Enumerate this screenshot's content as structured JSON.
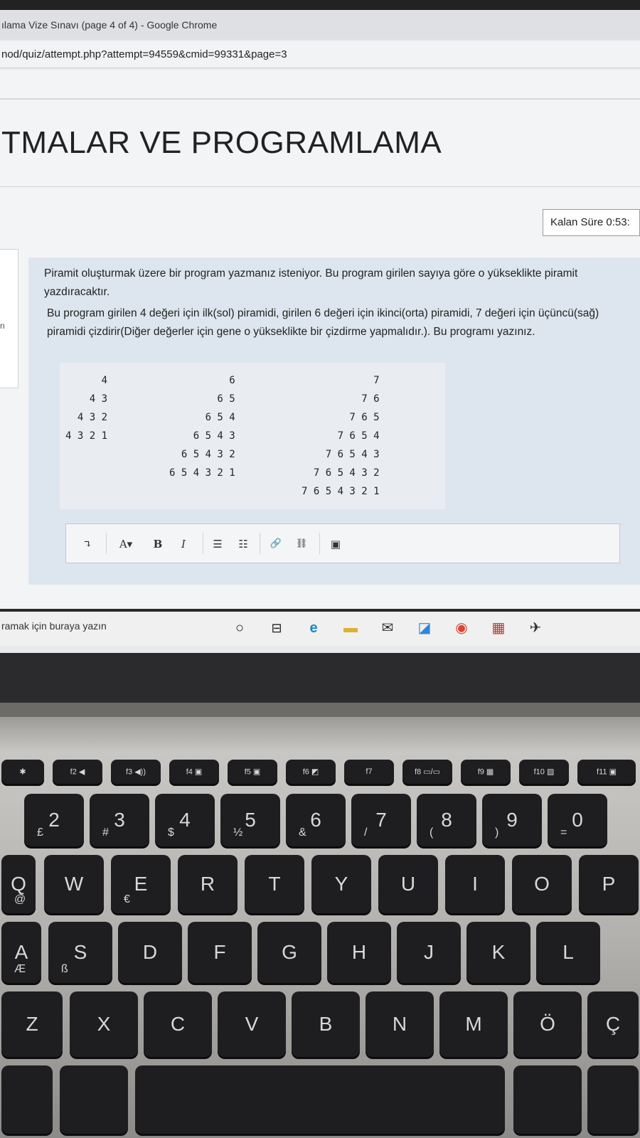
{
  "window": {
    "title": "ılama Vize Sınavı (page 4 of 4) - Google Chrome",
    "url": "nod/quiz/attempt.php?attempt=94559&cmid=99331&page=3"
  },
  "course": {
    "title": "TMALAR VE PROGRAMLAMA"
  },
  "timer": {
    "label": "Kalan Süre 0:53:"
  },
  "sidebar": {
    "fragment": "n"
  },
  "question": {
    "paragraph1": "Piramit oluşturmak üzere bir program yazmanız isteniyor. Bu program girilen sayıya göre o yükseklikte piramit yazdıracaktır.",
    "paragraph2": "Bu program girilen 4 değeri için ilk(sol) piramidi, girilen 6 değeri için ikinci(orta) piramidi, 7 değeri için üçüncü(sağ) piramidi çizdirir(Diğer değerler için gene o yükseklikte bir çizdirme yapmalıdır.). Bu programı yazınız.",
    "pyramid_left": "      4\n    4 3\n  4 3 2\n4 3 2 1",
    "pyramid_middle": "          6\n        6 5\n      6 5 4\n    6 5 4 3\n  6 5 4 3 2\n6 5 4 3 2 1",
    "pyramid_right": "            7\n          7 6\n        7 6 5\n      7 6 5 4\n    7 6 5 4 3\n  7 6 5 4 3 2\n7 6 5 4 3 2 1"
  },
  "editor_toolbar": {
    "expand": "↴",
    "font": "A▾",
    "bold": "B",
    "italic": "I",
    "bullets": "☰",
    "numbered": "☷",
    "link": "🔗",
    "unlink": "⛓",
    "image": "▣"
  },
  "taskbar": {
    "search": "ramak için buraya yazın",
    "icons": [
      "○",
      "⊟",
      "e",
      "▬",
      "✉",
      "◪",
      "◉",
      "▦",
      "✈"
    ]
  },
  "keyboard": {
    "fn_row": [
      "✱",
      "f2 ◀",
      "f3 ◀))",
      "f4 ▣",
      "f5 ▣",
      "f6 ◩",
      "f7",
      "f8 ▭/▭",
      "f9 ▦",
      "f10 ▨",
      "f11 ▣"
    ],
    "num_row": [
      {
        "main": "2",
        "sub": "£"
      },
      {
        "main": "3",
        "sub": "#"
      },
      {
        "main": "4",
        "sub": "$"
      },
      {
        "main": "5",
        "sub": "½"
      },
      {
        "main": "6",
        "sub": "&"
      },
      {
        "main": "7",
        "sub": "/"
      },
      {
        "main": "8",
        "sub": "("
      },
      {
        "main": "9",
        "sub": ")"
      },
      {
        "main": "0",
        "sub": "="
      }
    ],
    "row_q": [
      {
        "main": "Q",
        "sub": "@"
      },
      {
        "main": "W",
        "sub": ""
      },
      {
        "main": "E",
        "sub": "€"
      },
      {
        "main": "R",
        "sub": ""
      },
      {
        "main": "T",
        "sub": ""
      },
      {
        "main": "Y",
        "sub": ""
      },
      {
        "main": "U",
        "sub": ""
      },
      {
        "main": "I",
        "sub": ""
      },
      {
        "main": "O",
        "sub": ""
      },
      {
        "main": "P",
        "sub": ""
      }
    ],
    "row_a": [
      {
        "main": "A",
        "sub": "Æ"
      },
      {
        "main": "S",
        "sub": "ß"
      },
      {
        "main": "D",
        "sub": ""
      },
      {
        "main": "F",
        "sub": ""
      },
      {
        "main": "G",
        "sub": ""
      },
      {
        "main": "H",
        "sub": ""
      },
      {
        "main": "J",
        "sub": ""
      },
      {
        "main": "K",
        "sub": ""
      },
      {
        "main": "L",
        "sub": ""
      }
    ],
    "row_z": [
      {
        "main": "Z",
        "sub": ""
      },
      {
        "main": "X",
        "sub": ""
      },
      {
        "main": "C",
        "sub": ""
      },
      {
        "main": "V",
        "sub": ""
      },
      {
        "main": "B",
        "sub": ""
      },
      {
        "main": "N",
        "sub": ""
      },
      {
        "main": "M",
        "sub": ""
      },
      {
        "main": "Ö",
        "sub": ""
      },
      {
        "main": "Ç",
        "sub": ""
      }
    ]
  }
}
